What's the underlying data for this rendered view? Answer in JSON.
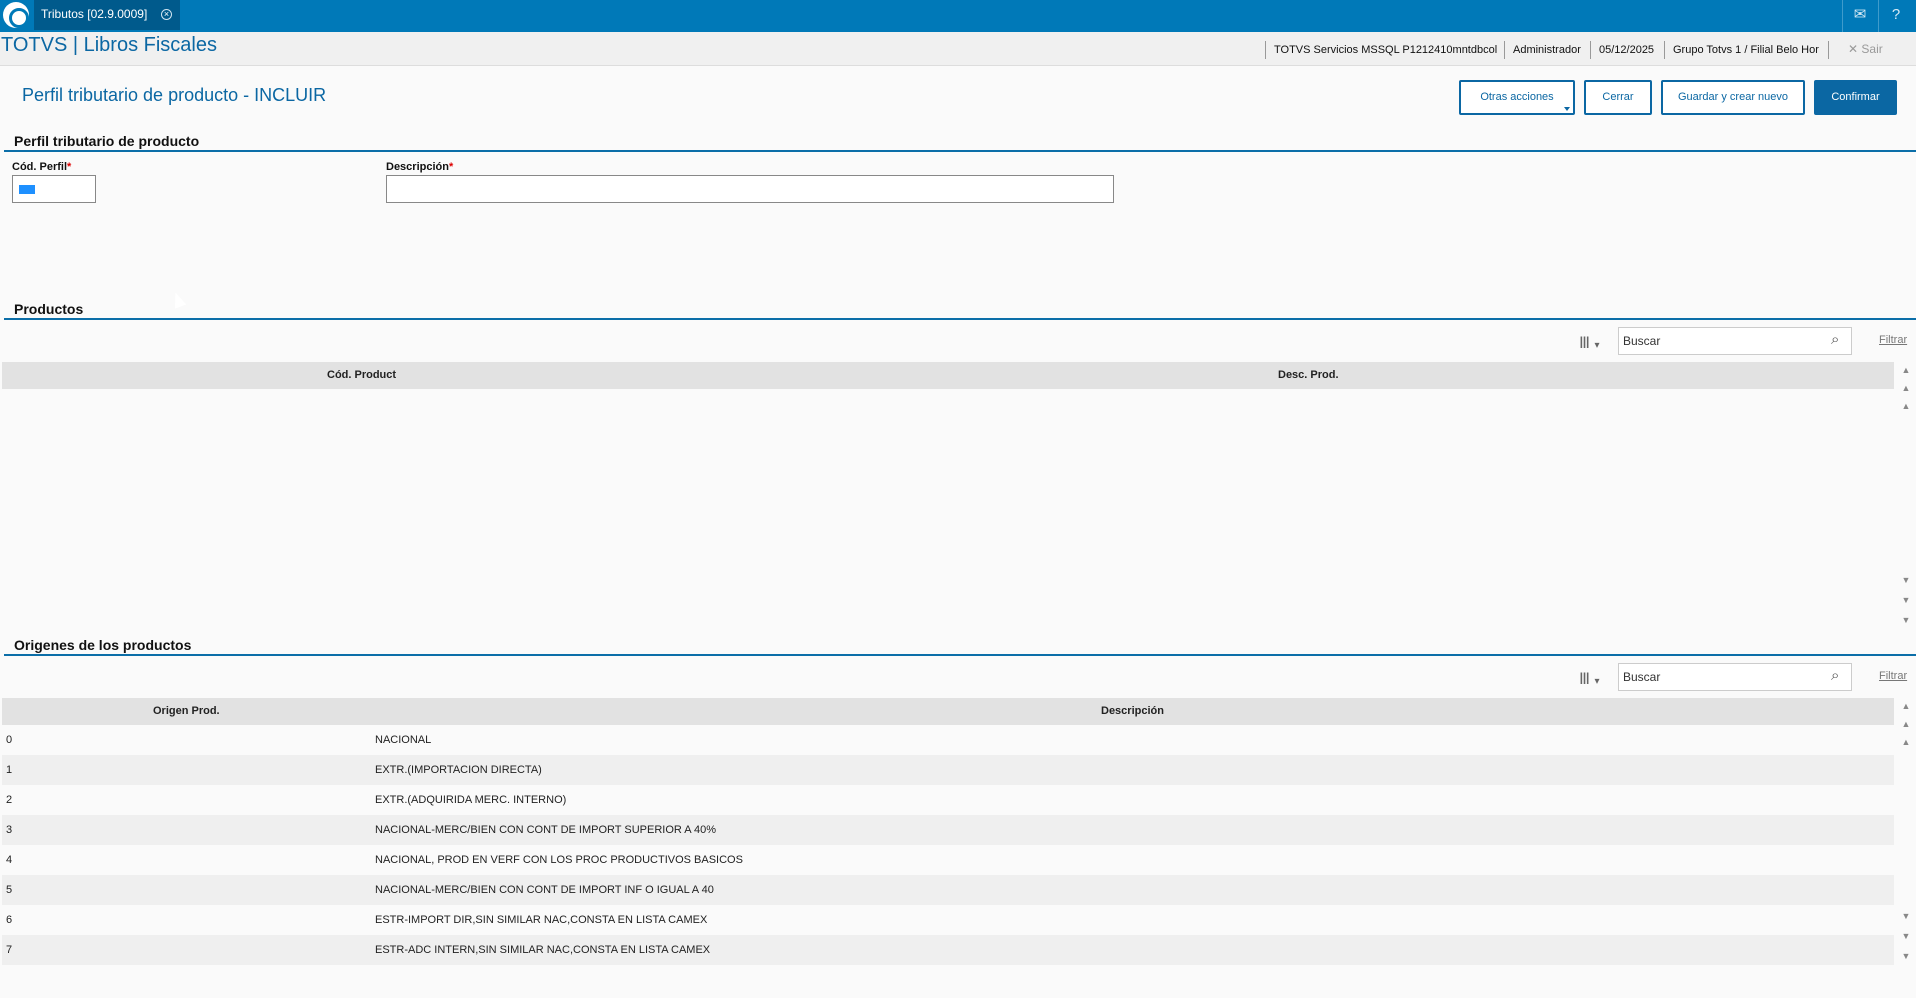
{
  "tab": {
    "title": "Tributos [02.9.0009]"
  },
  "header": {
    "app_title": "TOTVS | Libros Fiscales",
    "server": "TOTVS Servicios MSSQL P1212410mntdbcol",
    "user": "Administrador",
    "date": "05/12/2025",
    "branch": "Grupo Totvs 1 / Filial Belo Hor",
    "exit": "Sair"
  },
  "page": {
    "title": "Perfil tributario de producto - INCLUIR"
  },
  "actions": {
    "other_actions": "Otras acciones",
    "close": "Cerrar",
    "save_new": "Guardar y crear nuevo",
    "confirm": "Confirmar"
  },
  "profile": {
    "section_title": "Perfil tributario de producto",
    "code_label": "Cód. Perfil",
    "description_label": "Descripción",
    "code_value": "",
    "description_value": ""
  },
  "products": {
    "section_title": "Productos",
    "search_placeholder": "Buscar",
    "filter": "Filtrar",
    "columns": [
      "Cód. Product",
      "Desc. Prod."
    ]
  },
  "origins": {
    "section_title": "Origenes de los productos",
    "search_placeholder": "Buscar",
    "filter": "Filtrar",
    "columns": [
      "Origen Prod.",
      "Descripción"
    ],
    "rows": [
      {
        "code": "0",
        "description": "NACIONAL"
      },
      {
        "code": "1",
        "description": "EXTR.(IMPORTACION DIRECTA)"
      },
      {
        "code": "2",
        "description": "EXTR.(ADQUIRIDA MERC. INTERNO)"
      },
      {
        "code": "3",
        "description": "NACIONAL-MERC/BIEN CON CONT DE IMPORT SUPERIOR A 40%"
      },
      {
        "code": "4",
        "description": "NACIONAL, PROD EN VERF CON LOS PROC PRODUCTIVOS BASICOS"
      },
      {
        "code": "5",
        "description": "NACIONAL-MERC/BIEN CON CONT DE IMPORT INF O IGUAL A 40"
      },
      {
        "code": "6",
        "description": "ESTR-IMPORT DIR,SIN SIMILAR NAC,CONSTA EN LISTA CAMEX"
      },
      {
        "code": "7",
        "description": "ESTR-ADC INTERN,SIN SIMILAR NAC,CONSTA EN LISTA CAMEX"
      }
    ]
  },
  "colors": {
    "brand": "#0079b8",
    "accent": "#0b67a3",
    "required": "#dd0000"
  }
}
